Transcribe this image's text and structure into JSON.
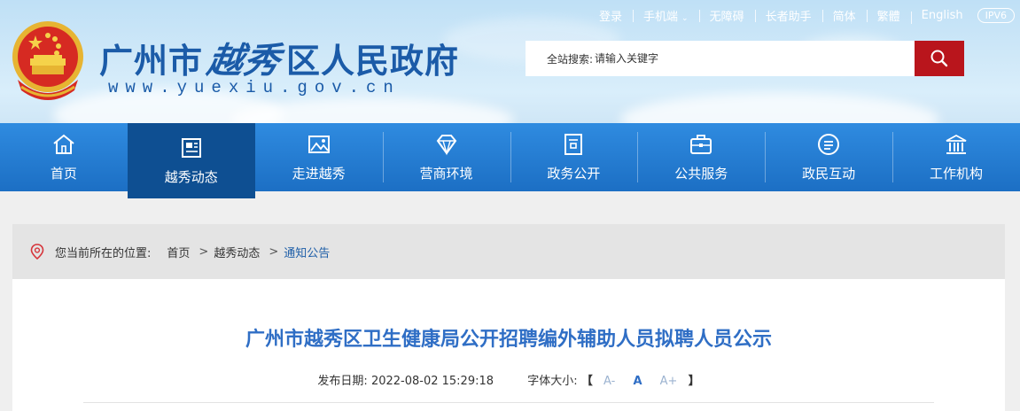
{
  "header": {
    "title_prefix": "广州市",
    "title_calligraphy": "越秀",
    "title_suffix": "区人民政府",
    "url": "www.yuexiu.gov.cn"
  },
  "toplinks": [
    {
      "label": "登录"
    },
    {
      "label": "手机端",
      "dropdown": true
    },
    {
      "label": "无障碍"
    },
    {
      "label": "长者助手"
    },
    {
      "label": "简体"
    },
    {
      "label": "繁體"
    },
    {
      "label": "English"
    }
  ],
  "ipv6_badge": "IPV6",
  "search": {
    "label": "全站搜索:",
    "placeholder": "请输入关键字",
    "button_icon": "search-icon"
  },
  "nav": [
    {
      "label": "首页",
      "icon": "home-icon"
    },
    {
      "label": "越秀动态",
      "icon": "newspaper-icon",
      "active": true
    },
    {
      "label": "走进越秀",
      "icon": "image-icon"
    },
    {
      "label": "营商环境",
      "icon": "diamond-icon"
    },
    {
      "label": "政务公开",
      "icon": "document-icon"
    },
    {
      "label": "公共服务",
      "icon": "briefcase-icon"
    },
    {
      "label": "政民互动",
      "icon": "chat-icon"
    },
    {
      "label": "工作机构",
      "icon": "building-icon"
    }
  ],
  "breadcrumb": {
    "label": "您当前所在的位置:",
    "items": [
      "首页",
      "越秀动态",
      "通知公告"
    ]
  },
  "article": {
    "title": "广州市越秀区卫生健康局公开招聘编外辅助人员拟聘人员公示",
    "date_label": "发布日期:",
    "date": "2022-08-02 15:29:18",
    "font_size_label": "字体大小:",
    "bracket_open": "【",
    "bracket_close": "】",
    "font_small": "A-",
    "font_mid": "A",
    "font_big": "A+"
  },
  "colors": {
    "nav_bg": "#1c6fc4",
    "nav_active": "#0e4f92",
    "title_blue": "#2f6ec5",
    "search_red": "#b9151c"
  }
}
